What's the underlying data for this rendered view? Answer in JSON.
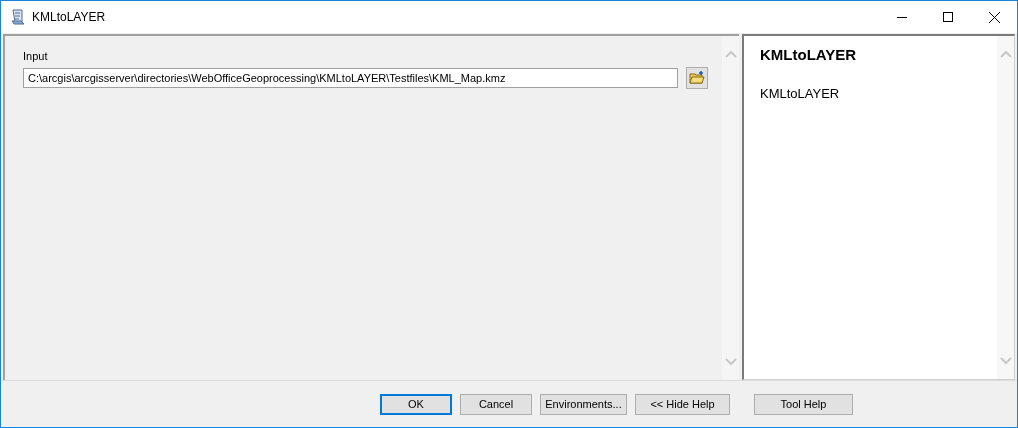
{
  "window": {
    "title": "KMLtoLAYER"
  },
  "input": {
    "label": "Input",
    "value": "C:\\arcgis\\arcgisserver\\directories\\WebOfficeGeoprocessing\\KMLtoLAYER\\Testfiles\\KML_Map.kmz"
  },
  "help": {
    "title": "KMLtoLAYER",
    "text": "KMLtoLAYER"
  },
  "buttons": [
    {
      "label": "OK",
      "default": true
    },
    {
      "label": "Cancel",
      "default": false
    },
    {
      "label": "Environments...",
      "default": false
    },
    {
      "label": "<< Hide Help",
      "default": false
    },
    {
      "label": "Tool Help",
      "default": false
    }
  ]
}
